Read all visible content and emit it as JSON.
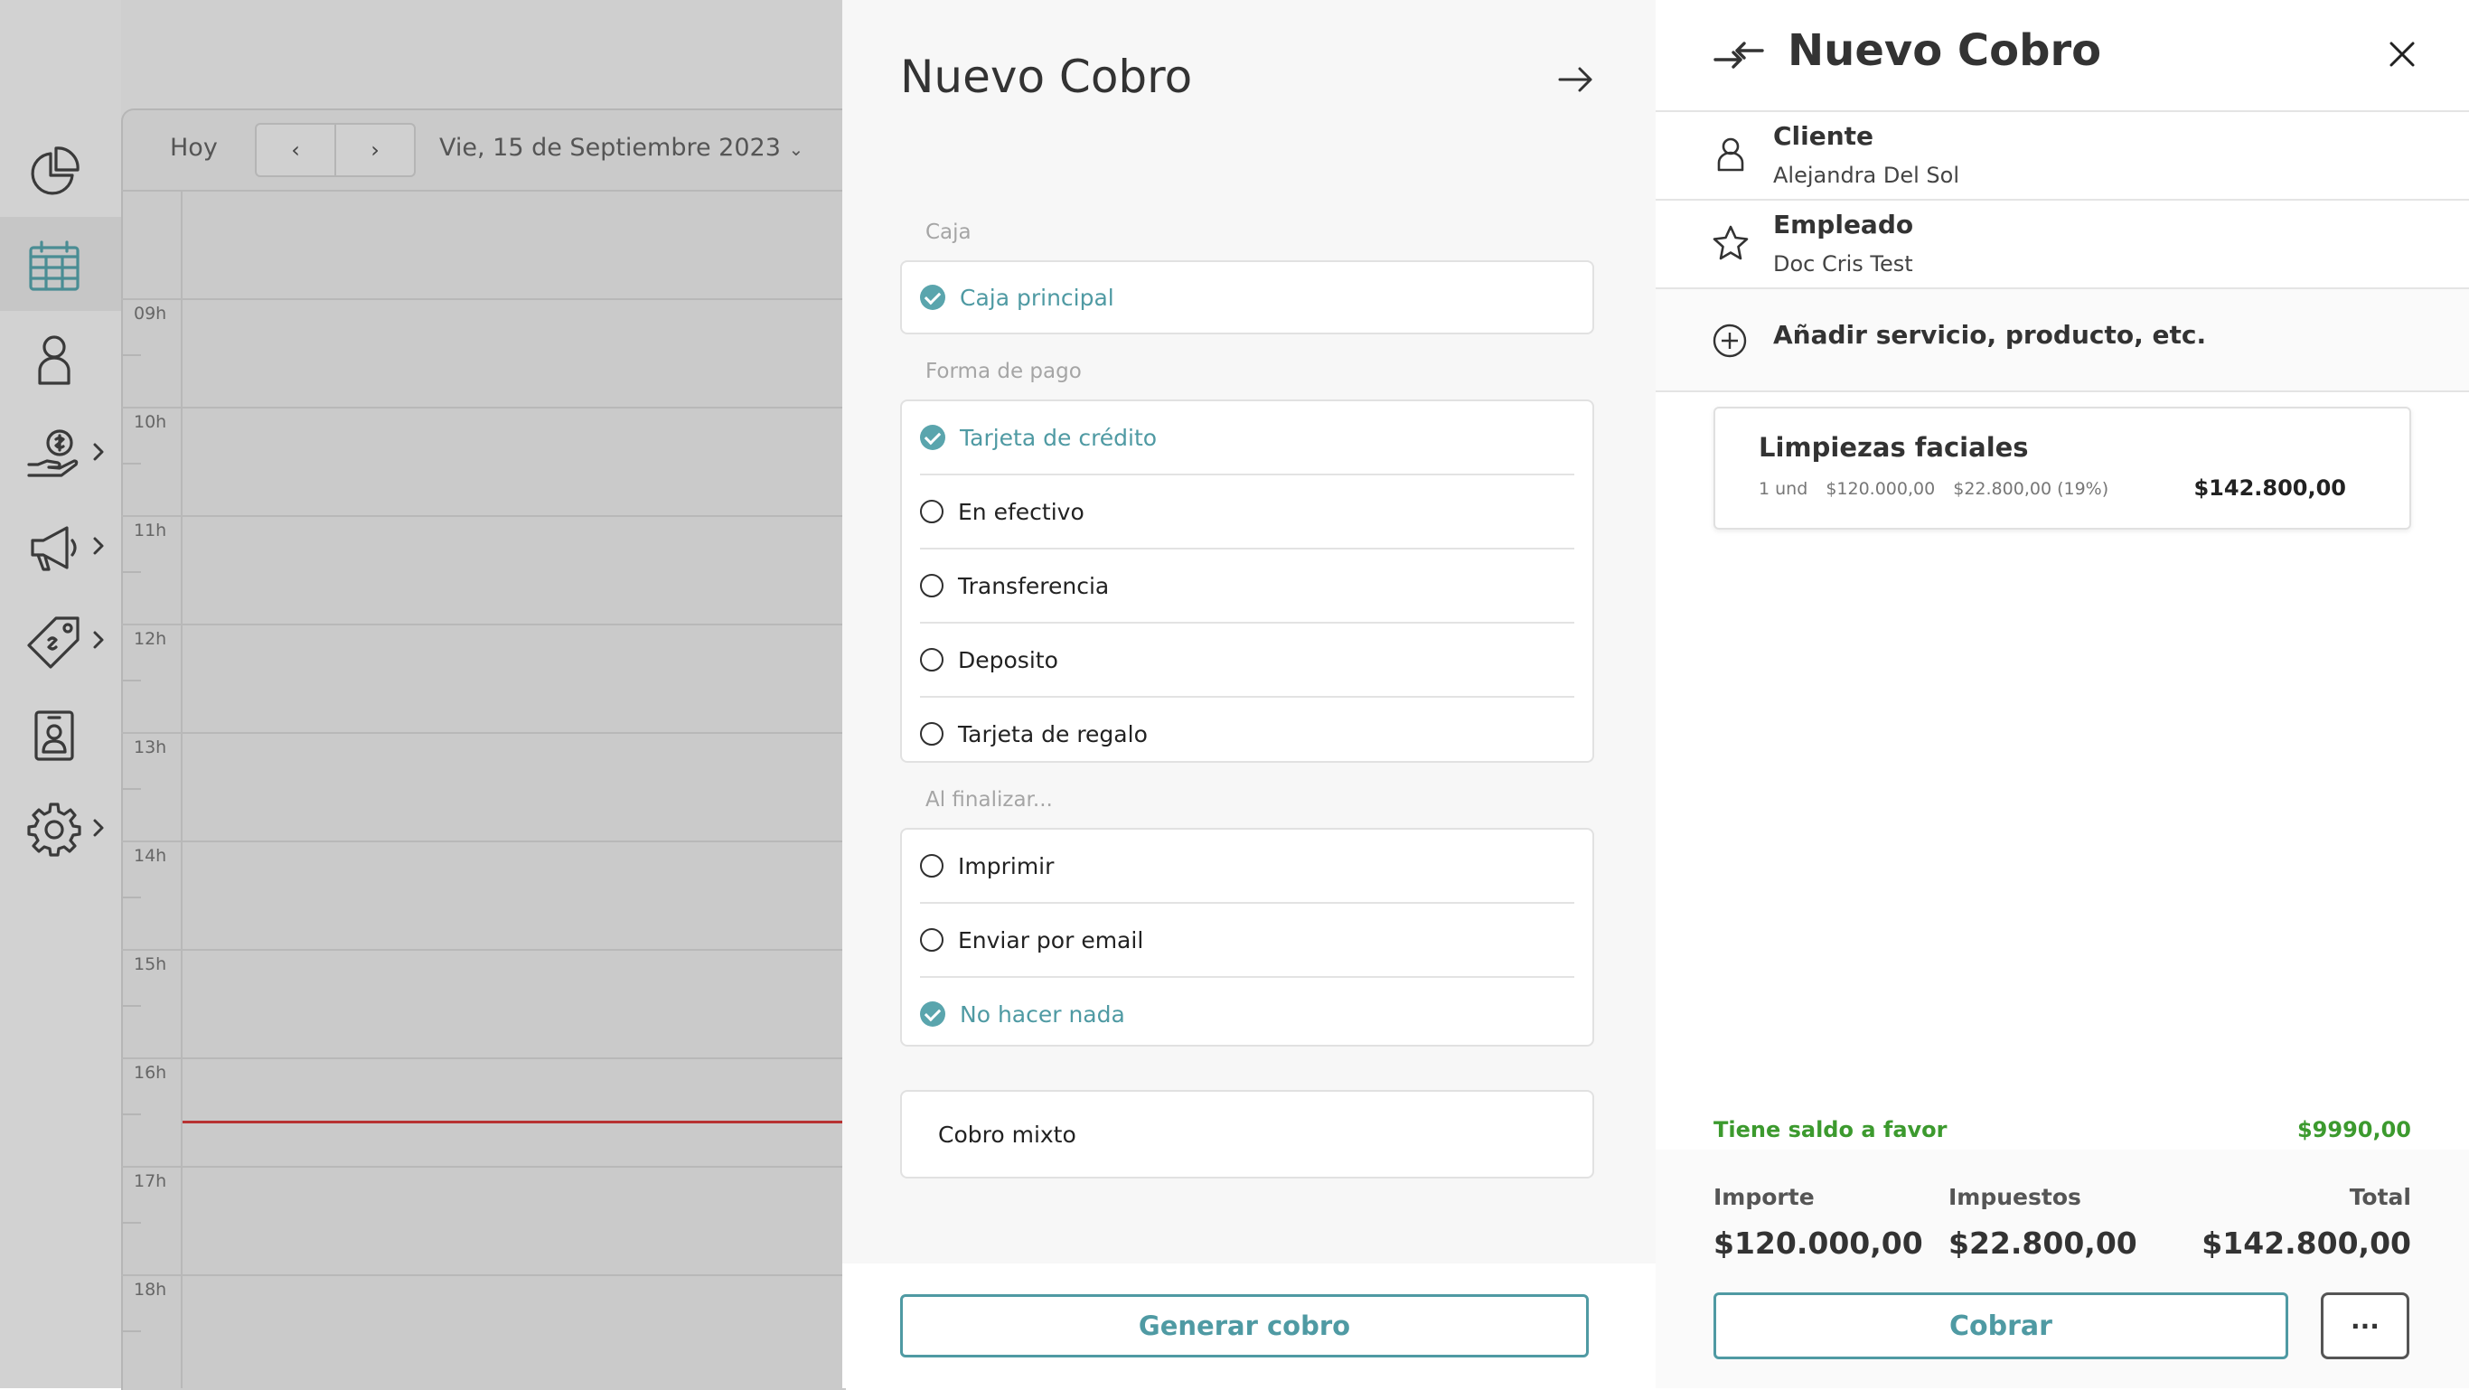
{
  "background": {
    "toolbar": {
      "today_label": "Hoy",
      "prev_label": "‹",
      "next_label": "›",
      "date_label": "Vie, 15 de Septiembre 2023",
      "date_caret": "⌄"
    },
    "hours": [
      "09h",
      "10h",
      "11h",
      "12h",
      "13h",
      "14h",
      "15h",
      "16h",
      "17h",
      "18h"
    ],
    "sidebar_icons": [
      "chart-pie-icon",
      "calendar-icon",
      "user-icon",
      "money-hand-icon",
      "megaphone-icon",
      "price-tag-icon",
      "contact-card-icon",
      "gear-icon"
    ]
  },
  "payment_panel": {
    "title": "Nuevo Cobro",
    "caja": {
      "label": "Caja",
      "options": [
        {
          "label": "Caja principal",
          "selected": true
        }
      ]
    },
    "forma_pago": {
      "label": "Forma de pago",
      "options": [
        {
          "label": "Tarjeta de crédito",
          "selected": true
        },
        {
          "label": "En efectivo",
          "selected": false
        },
        {
          "label": "Transferencia",
          "selected": false
        },
        {
          "label": "Deposito",
          "selected": false
        },
        {
          "label": "Tarjeta de regalo",
          "selected": false
        }
      ]
    },
    "al_finalizar": {
      "label": "Al finalizar...",
      "options": [
        {
          "label": "Imprimir",
          "selected": false
        },
        {
          "label": "Enviar por email",
          "selected": false
        },
        {
          "label": "No hacer nada",
          "selected": true
        }
      ]
    },
    "cobro_mixto_label": "Cobro mixto",
    "generate_button": "Generar cobro"
  },
  "summary_panel": {
    "title": "Nuevo Cobro",
    "client": {
      "label": "Cliente",
      "value": "Alejandra Del Sol"
    },
    "employee": {
      "label": "Empleado",
      "value": "Doc Cris Test"
    },
    "add_label": "Añadir servicio, producto, etc.",
    "item": {
      "name": "Limpiezas faciales",
      "qty": "1 und",
      "price": "$120.000,00",
      "tax": "$22.800,00 (19%)",
      "total": "$142.800,00"
    },
    "credit": {
      "label": "Tiene saldo a favor",
      "value": "$9990,00"
    },
    "totals": {
      "importe_label": "Importe",
      "importe_value": "$120.000,00",
      "impuestos_label": "Impuestos",
      "impuestos_value": "$22.800,00",
      "total_label": "Total",
      "total_value": "$142.800,00"
    },
    "cobrar_button": "Cobrar",
    "more_button": "···"
  },
  "colors": {
    "accent": "#4f9aa3",
    "check": "#5aa5ad",
    "credit_green": "#3c9a2e",
    "now_line": "#b73232"
  }
}
